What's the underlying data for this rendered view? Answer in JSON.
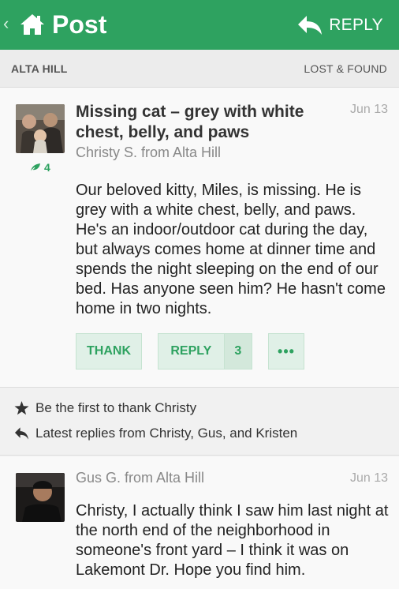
{
  "header": {
    "title": "Post",
    "reply_label": "REPLY"
  },
  "subheader": {
    "neighborhood": "ALTA HILL",
    "category": "LOST & FOUND"
  },
  "post": {
    "title": "Missing cat – grey with white chest, belly, and paws",
    "author": "Christy S. from Alta Hill",
    "date": "Jun 13",
    "thanks_count": "4",
    "body": "Our beloved kitty, Miles, is missing. He is grey with a white chest, belly, and paws. He's an indoor/outdoor cat during the day, but always comes home at dinner time and spends the night sleeping on the end of our bed. Has anyone seen him? He hasn't come home in two nights.",
    "actions": {
      "thank_label": "THANK",
      "reply_label": "REPLY",
      "reply_count": "3",
      "more_label": "•••"
    }
  },
  "activity": {
    "thank_text": "Be the first to thank Christy",
    "replies_text": "Latest replies from Christy, Gus, and Kristen"
  },
  "reply": {
    "author": "Gus G. from Alta Hill",
    "date": "Jun 13",
    "body": "Christy, I actually think I saw him last night at the north end of the neighborhood in someone's front yard – I think it was on Lakemont Dr. Hope you find him."
  },
  "colors": {
    "brand_green": "#2ea260",
    "button_bg": "#e0f0e7"
  },
  "icons": [
    "chevron-left-icon",
    "home-icon",
    "reply-arrow-icon",
    "leaf-icon",
    "star-icon"
  ]
}
